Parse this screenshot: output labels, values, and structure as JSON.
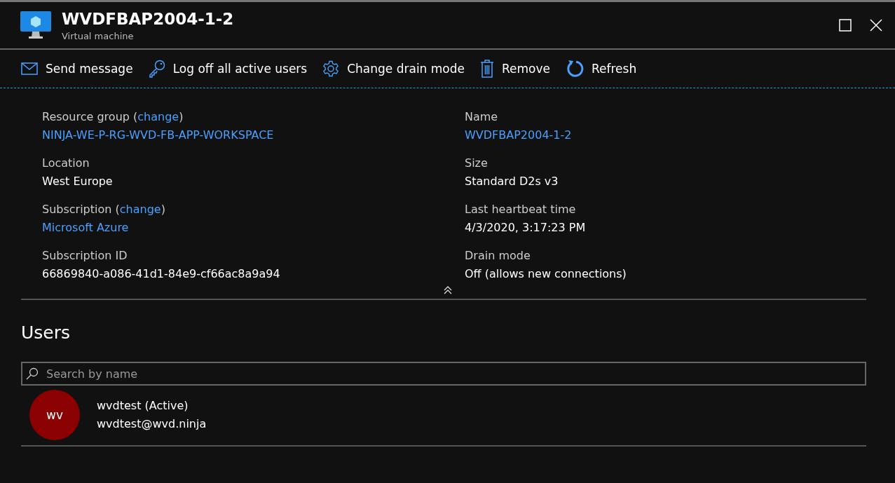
{
  "header": {
    "title": "WVDFBAP2004-1-2",
    "subtitle": "Virtual machine"
  },
  "toolbar": [
    {
      "kind": "mail",
      "label": "Send message"
    },
    {
      "kind": "key",
      "label": "Log off all active users"
    },
    {
      "kind": "gear",
      "label": "Change drain mode"
    },
    {
      "kind": "trash",
      "label": "Remove"
    },
    {
      "kind": "refresh",
      "label": "Refresh"
    }
  ],
  "properties": [
    [
      {
        "label": "Resource group (",
        "link": "change",
        "label_end": ")",
        "value": "NINJA-WE-P-RG-WVD-FB-APP-WORKSPACE",
        "kind": "link"
      },
      {
        "label": "Location",
        "value": "West Europe",
        "kind": "text"
      },
      {
        "label": "Subscription (",
        "link": "change",
        "label_end": ")",
        "value": "Microsoft Azure",
        "kind": "link"
      },
      {
        "label": "Subscription ID",
        "value": "66869840-a086-41d1-84e9-cf66ac8a9a94",
        "kind": "text"
      }
    ],
    [
      {
        "label": "Name",
        "value": "WVDFBAP2004-1-2",
        "kind": "link"
      },
      {
        "label": "Size",
        "value": "Standard D2s v3",
        "kind": "text"
      },
      {
        "label": "Last heartbeat time",
        "value": "4/3/2020, 3:17:23 PM",
        "kind": "text"
      },
      {
        "label": "Drain mode",
        "value": "Off (allows new connections)",
        "kind": "text"
      }
    ]
  ],
  "users": {
    "heading": "Users",
    "search": {
      "placeholder": "Search by name"
    },
    "items": [
      {
        "initials": "wv",
        "color": "#8b0000",
        "name": "wvdtest (Active)",
        "email": "wvdtest@wvd.ninja"
      }
    ]
  }
}
